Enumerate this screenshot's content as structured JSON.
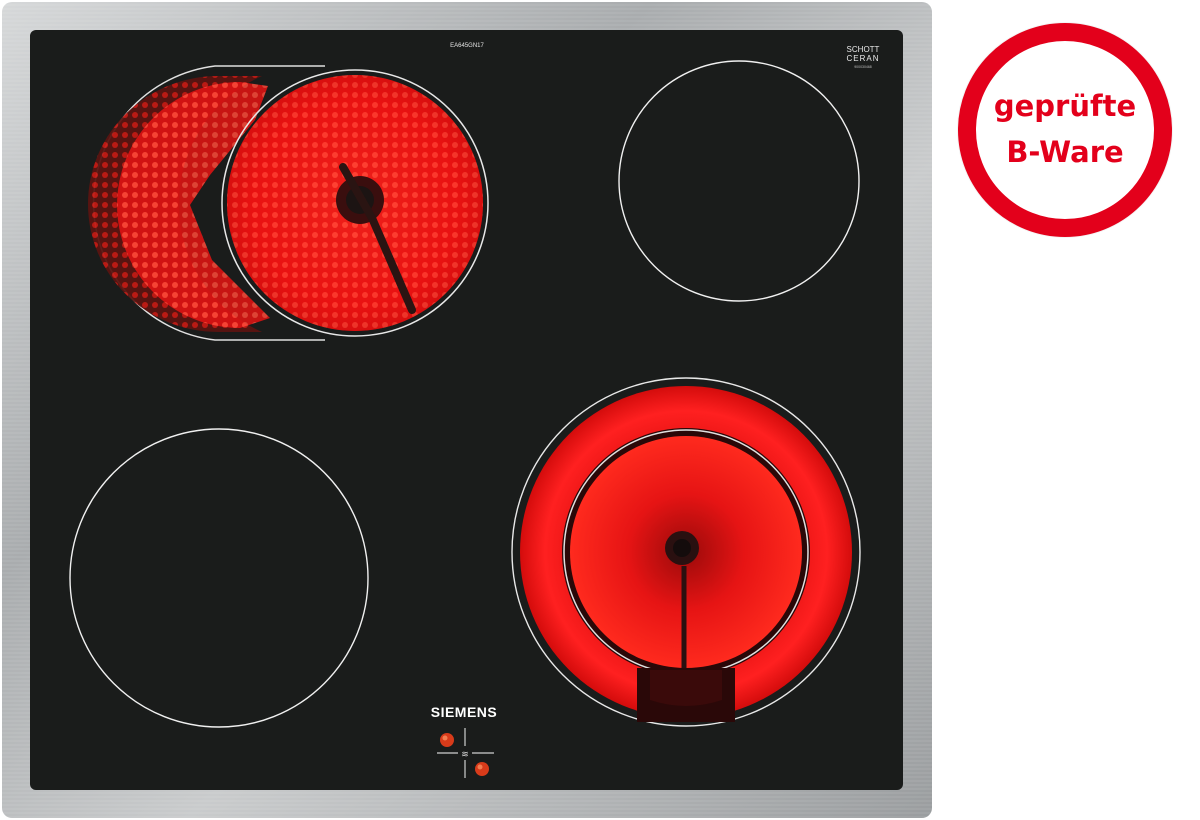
{
  "product": {
    "model_code": "EA645GN17",
    "glass_brand_line1": "SCHOTT",
    "glass_brand_line2": "CERAN",
    "serial_small": "900030468",
    "brand": "SIEMENS"
  },
  "zones": [
    {
      "name": "front-left-zone",
      "state": "off"
    },
    {
      "name": "rear-left-zone",
      "state": "on",
      "type": "dual-extended"
    },
    {
      "name": "rear-right-zone",
      "state": "off"
    },
    {
      "name": "front-right-zone",
      "state": "on",
      "type": "dual-circuit"
    }
  ],
  "controls": {
    "knob_icon": "heat-waves-icon"
  },
  "badge": {
    "line1": "geprüfte",
    "line2": "B-Ware"
  },
  "colors": {
    "frame": "#b9bcbd",
    "glass": "#1a1c1b",
    "heating": "#ff1a1a",
    "badge_red": "#e3001b"
  }
}
